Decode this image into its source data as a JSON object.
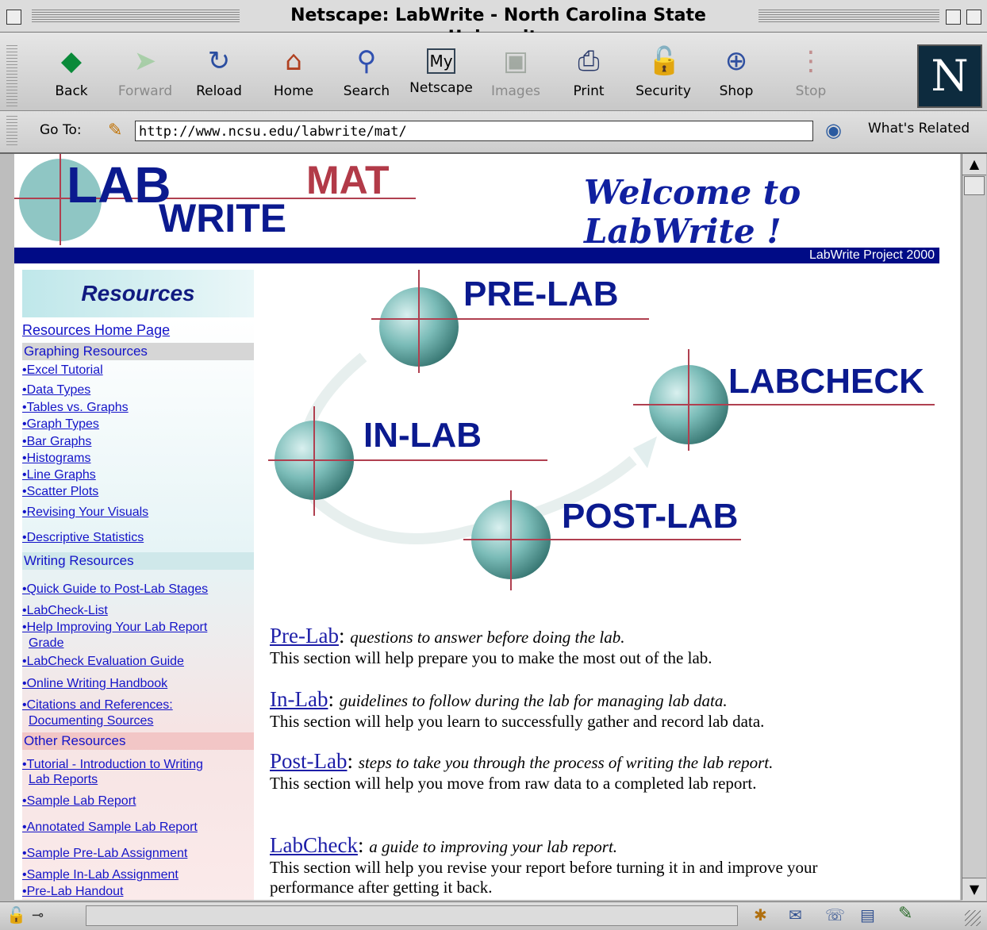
{
  "window": {
    "title": "Netscape: LabWrite - North Carolina State University"
  },
  "toolbar": {
    "buttons": [
      {
        "label": "Back",
        "icon": "back-arrow-icon",
        "enabled": true
      },
      {
        "label": "Forward",
        "icon": "forward-arrow-icon",
        "enabled": false
      },
      {
        "label": "Reload",
        "icon": "reload-icon",
        "enabled": true
      },
      {
        "label": "Home",
        "icon": "home-icon",
        "enabled": true
      },
      {
        "label": "Search",
        "icon": "search-icon",
        "enabled": true
      },
      {
        "label": "Netscape",
        "icon": "my-netscape-icon",
        "enabled": true
      },
      {
        "label": "Images",
        "icon": "images-icon",
        "enabled": false
      },
      {
        "label": "Print",
        "icon": "print-icon",
        "enabled": true
      },
      {
        "label": "Security",
        "icon": "lock-icon",
        "enabled": true
      },
      {
        "label": "Shop",
        "icon": "shop-bag-icon",
        "enabled": true
      },
      {
        "label": "Stop",
        "icon": "stop-light-icon",
        "enabled": false
      }
    ],
    "logo_letter": "N"
  },
  "location": {
    "label": "Go To:",
    "url": "http://www.ncsu.edu/labwrite/mat/",
    "related_label": "What's Related"
  },
  "banner": {
    "lab": "LAB",
    "write": "WRITE",
    "mat": "MAT",
    "welcome": "Welcome to LabWrite !",
    "project": "LabWrite Project 2000"
  },
  "sidebar": {
    "title": "Resources",
    "home_link": "Resources Home Page",
    "graphing_header": "Graphing Resources",
    "graphing_links": [
      "•Excel Tutorial",
      "•Data Types ",
      "•Tables vs. Graphs",
      "•Graph Types",
      "•Bar Graphs",
      "•Histograms",
      "•Line Graphs",
      "•Scatter Plots",
      "•Revising Your Visuals",
      "•Descriptive Statistics"
    ],
    "writing_header": "Writing Resources",
    "writing_links": [
      "•Quick Guide to Post-Lab Stages",
      "•LabCheck-List",
      "•Help Improving Your Lab Report",
      "Grade",
      "•LabCheck Evaluation Guide",
      "•Online Writing Handbook",
      "•Citations and References:",
      "Documenting Sources"
    ],
    "other_header": "Other Resources",
    "other_links": [
      "•Tutorial - Introduction to Writing",
      "Lab Reports",
      "•Sample Lab Report",
      "•Annotated Sample Lab Report",
      "•Sample Pre-Lab Assignment",
      "•Sample In-Lab Assignment",
      "•Pre-Lab Handout"
    ]
  },
  "diagram": {
    "prelab": "PRE-LAB",
    "inlab": "IN-LAB",
    "postlab": "POST-LAB",
    "labcheck": "LABCHECK"
  },
  "sections": [
    {
      "name": "Pre-Lab",
      "desc": "questions to answer before doing the lab.",
      "body": "This section will help prepare you to make the most out of the lab."
    },
    {
      "name": "In-Lab",
      "desc": "guidelines to follow during the lab for managing lab data.",
      "body": "This section will help you learn to successfully gather and record lab data."
    },
    {
      "name": "Post-Lab",
      "desc": "steps to take you through the process of writing the lab report.",
      "body": "This section will help you move from raw data to a completed lab report."
    },
    {
      "name": "LabCheck",
      "desc": "a guide to improving your lab report.",
      "body": "This section will help you revise your report before turning it in and improve your performance after getting it back."
    }
  ],
  "colors": {
    "nav_blue": "#000b86",
    "link": "#1414c8",
    "header_gray": "#d8d8d8",
    "header_pink": "#f4c9c9"
  }
}
